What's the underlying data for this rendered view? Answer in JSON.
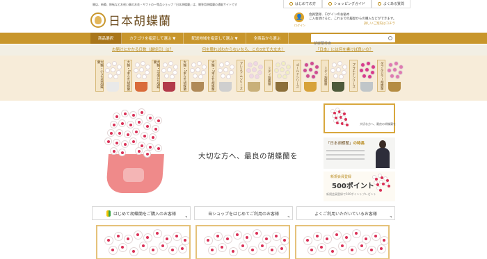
{
  "header": {
    "note": "開店、新築、移転などお祝い事のお花・ギフトの一等品ショップ「日本胡蝶蘭」は、贈答用胡蝶蘭の通販サイトです",
    "top_links": [
      {
        "label": "はじめての方",
        "icon": "info-icon"
      },
      {
        "label": "ショッピングガイド",
        "icon": "guide-icon"
      },
      {
        "label": "よくある質問",
        "icon": "question-icon"
      }
    ],
    "logo_text": "日本胡蝶蘭",
    "login": {
      "icon_label": "ログイン",
      "line1": "会員登録、ログインのお勧め",
      "line2": "ご入会頂けると、これまでの履歴からの購入などができます。",
      "link": "詳しいご案内はコチラ"
    }
  },
  "nav": {
    "items": [
      "商品選択",
      "カテゴリを指定して選ぶ ▼",
      "配送地域を指定して選ぶ ▼",
      "全商品から選ぶ"
    ],
    "search_placeholder": "胡蝶蘭検索"
  },
  "faq_links": [
    "お届けにかかる日数（最短日）は？",
    "何を贈ればわからないなら、この3文で大丈夫！",
    "『日本』には何を書けば良いの？"
  ],
  "categories": [
    {
      "label": "大輪・小さな白胡蝶蘭",
      "pot": "#e9e9e9",
      "bloom": "#ffffff"
    },
    {
      "label": "大輪・5本立ち胡蝶蘭",
      "pot": "#d96b3a",
      "bloom": "#ffffff"
    },
    {
      "label": "大輪・三本立ち胡蝶蘭",
      "pot": "#b23a4a",
      "bloom": "#ffffff"
    },
    {
      "label": "大輪・5本立ち胡蝶蘭",
      "pot": "#b08a58",
      "bloom": "#ffffff"
    },
    {
      "label": "大輪・3本立ち胡蝶蘭",
      "pot": "#cfcfcf",
      "bloom": "#ffffff"
    },
    {
      "label": "プレミアムシリーズ",
      "pot": "#c9b07a",
      "bloom": "#f0d6e4"
    },
    {
      "label": "ミディ胡蝶蘭",
      "pot": "#8c6f3a",
      "bloom": "#f1eec0"
    },
    {
      "label": "ゴールドシリーズ",
      "pot": "#d7a23a",
      "bloom": "#d14d90"
    },
    {
      "label": "ミディ胡蝶蘭",
      "pot": "#4e5a3a",
      "bloom": "#ffffff"
    },
    {
      "label": "プラチナシリーズ",
      "pot": "#c0c6c9",
      "bloom": "#d93c8a"
    },
    {
      "label": "ダブルカラー胡蝶蘭",
      "pot": "#b58c42",
      "bloom": "#e07bb0"
    }
  ],
  "hero": {
    "tagline": "大切な方へ、最良の胡蝶蘭を"
  },
  "side": {
    "thumb_label": "大切な方へ、最良の胡蝶蘭を",
    "feature_title_a": "「日本胡蝶蘭」",
    "feature_title_b": "の特長",
    "points_line1": "新規会員登録",
    "points_value": "500ポイント",
    "points_line3": "新規会員登録で500ポイントプレゼント"
  },
  "guides": [
    {
      "label": "はじめて胡蝶蘭をご購入のお客様",
      "icon": "beginner-leaf-icon"
    },
    {
      "label": "当ショップをはじめてご利用のお客様",
      "icon": ""
    },
    {
      "label": "よくご利用いただいているお客様",
      "icon": ""
    }
  ],
  "colors": {
    "accent": "#c8962c",
    "nav_active": "#a9761a",
    "faq_band": "#f2efe4",
    "category_band": "#f7ecd9"
  }
}
